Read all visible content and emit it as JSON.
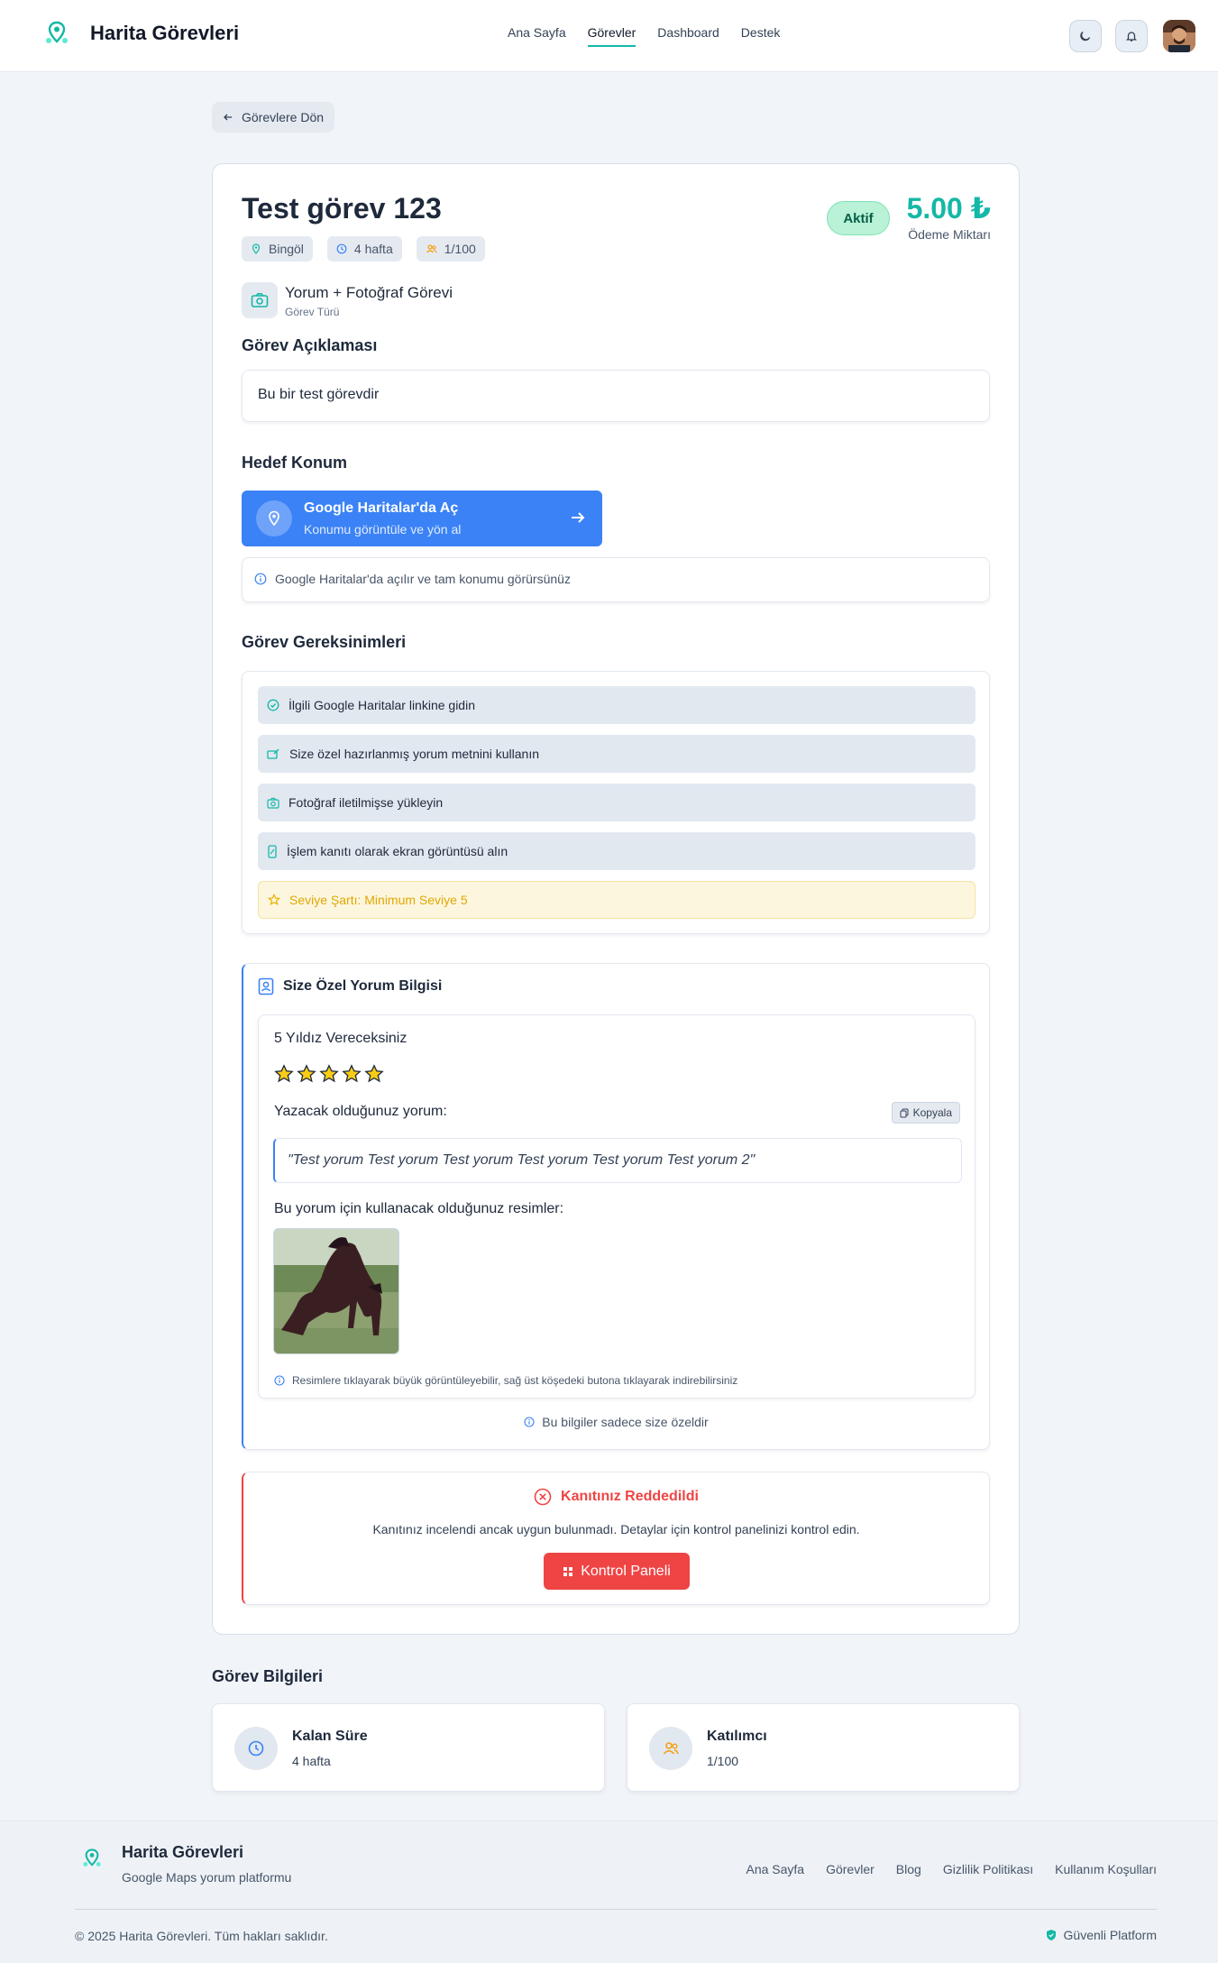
{
  "header": {
    "brand": "Harita Görevleri",
    "nav": [
      "Ana Sayfa",
      "Görevler",
      "Dashboard",
      "Destek"
    ],
    "active_nav": "Görevler",
    "icons": [
      "moon-icon",
      "bell-icon"
    ]
  },
  "back_button": "Görevlere Dön",
  "task": {
    "title": "Test görev 123",
    "chips": {
      "location": "Bingöl",
      "duration": "4 hafta",
      "participants": "1/100"
    },
    "status": "Aktif",
    "amount": "5.00 ₺",
    "amount_label": "Ödeme Miktarı",
    "type_name": "Yorum + Fotoğraf Görevi",
    "type_label": "Görev Türü"
  },
  "description": {
    "heading": "Görev Açıklaması",
    "text": "Bu bir test görevdir"
  },
  "location": {
    "heading": "Hedef Konum",
    "button_title": "Google Haritalar'da Aç",
    "button_sub": "Konumu görüntüle ve yön al",
    "info": "Google Haritalar'da açılır ve tam konumu görürsünüz"
  },
  "requirements": {
    "heading": "Görev Gereksinimleri",
    "items": [
      "İlgili Google Haritalar linkine gidin",
      "Size özel hazırlanmış yorum metnini kullanın",
      "Fotoğraf iletilmişse yükleyin",
      "İşlem kanıtı olarak ekran görüntüsü alın"
    ],
    "level": "Seviye Şartı: Minimum Seviye 5"
  },
  "review": {
    "heading": "Size Özel Yorum Bilgisi",
    "stars_label": "5 Yıldız Vereceksiniz",
    "stars": 5,
    "comment_label": "Yazacak olduğunuz yorum:",
    "copy": "Kopyala",
    "comment": "\"Test yorum Test yorum Test yorum Test yorum Test yorum Test yorum 2\"",
    "images_label": "Bu yorum için kullanacak olduğunuz resimler:",
    "image_hint": "Resimlere tıklayarak büyük görüntüleyebilir, sağ üst köşedeki butona tıklayarak indirebilirsiniz",
    "private_note": "Bu bilgiler sadece size özeldir"
  },
  "rejection": {
    "title": "Kanıtınız Reddedildi",
    "text": "Kanıtınız incelendi ancak uygun bulunmadı. Detaylar için kontrol panelinizi kontrol edin.",
    "button": "Kontrol Paneli"
  },
  "info": {
    "heading": "Görev Bilgileri",
    "remaining_label": "Kalan Süre",
    "remaining_value": "4 hafta",
    "participants_label": "Katılımcı",
    "participants_value": "1/100"
  },
  "footer": {
    "brand": "Harita Görevleri",
    "tagline": "Google Maps yorum platformu",
    "links": [
      "Ana Sayfa",
      "Görevler",
      "Blog",
      "Gizlilik Politikası",
      "Kullanım Koşulları"
    ],
    "copyright": "© 2025 Harita Görevleri. Tüm hakları saklıdır.",
    "secure": "Güvenli Platform"
  },
  "colors": {
    "accent": "#14b8a6",
    "blue": "#3b82f6",
    "danger": "#ef4444",
    "star": "#facc15"
  }
}
